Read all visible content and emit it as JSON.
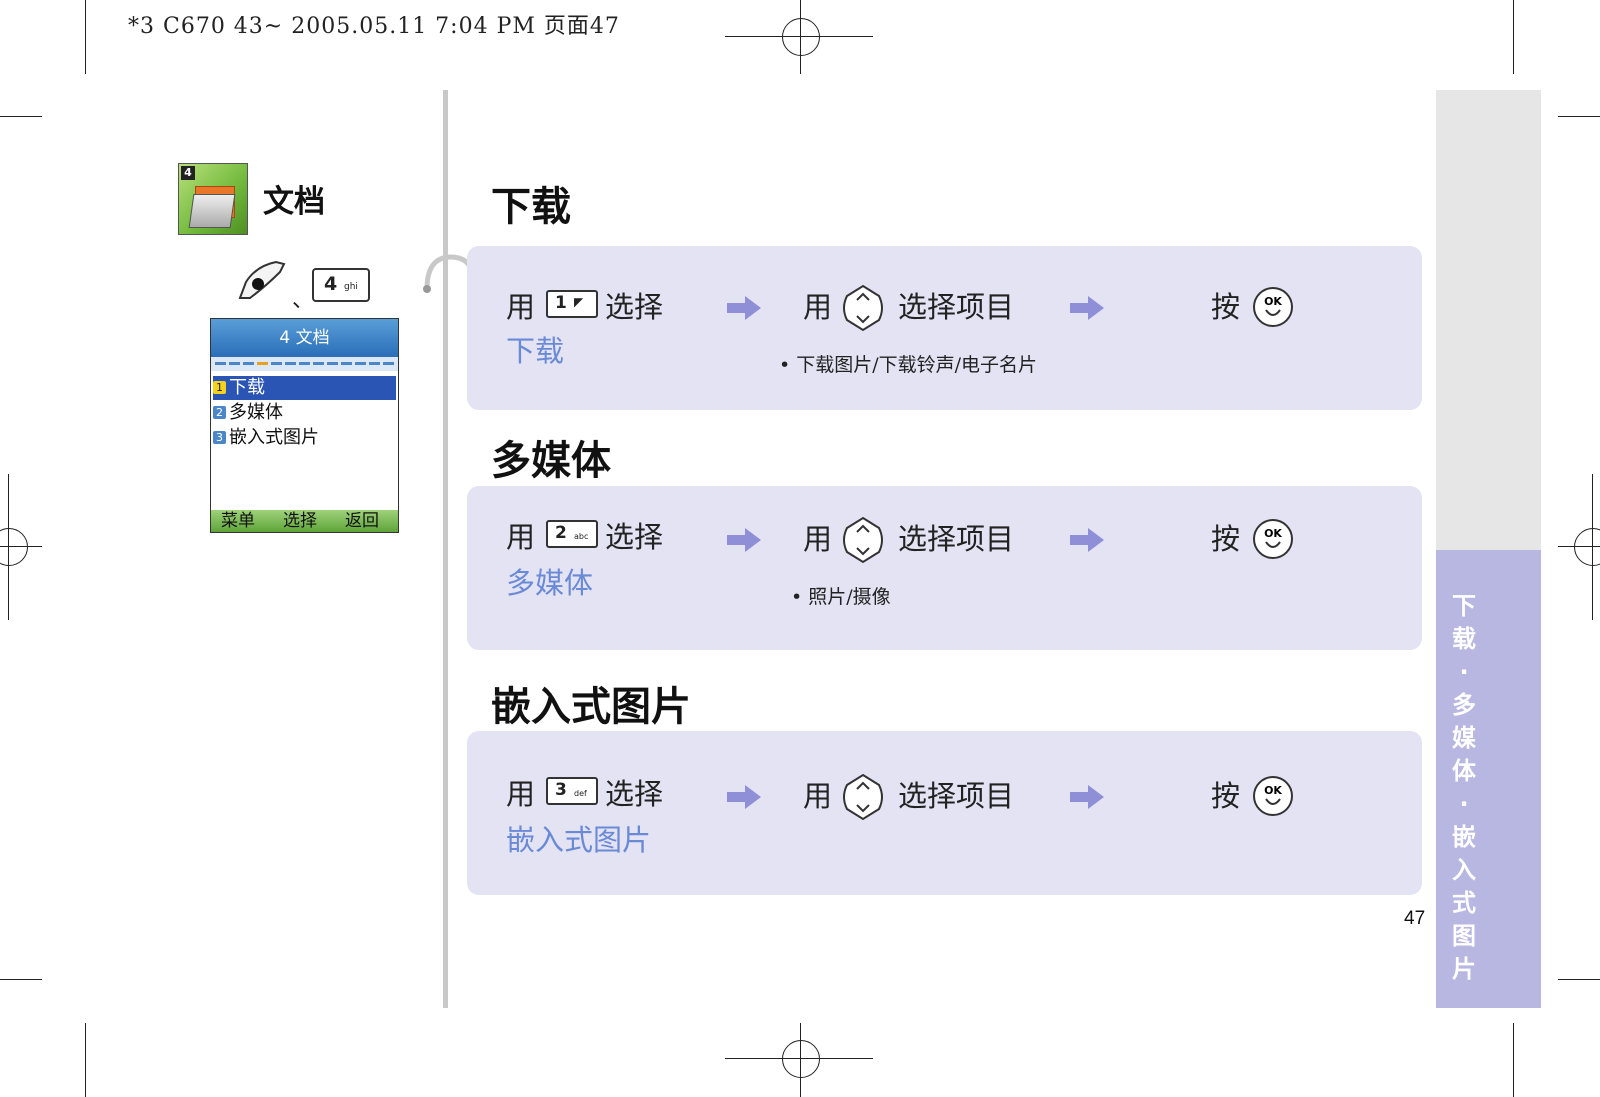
{
  "header": {
    "print_info": "*3 C670 43~ 2005.05.11 7:04 PM 页面47"
  },
  "sidebar": {
    "app_icon_number": "4",
    "app_title": "文档",
    "shortcut_separator": "、",
    "shortcut_key": {
      "digit": "4",
      "letters": "ghi"
    },
    "phone": {
      "title": "4 文档",
      "items": [
        {
          "num": "1",
          "label": "下载",
          "selected": true
        },
        {
          "num": "2",
          "label": "多媒体",
          "selected": false
        },
        {
          "num": "3",
          "label": "嵌入式图片",
          "selected": false
        }
      ],
      "softkeys": [
        "菜单",
        "选择",
        "返回"
      ]
    }
  },
  "sections": [
    {
      "title": "下载",
      "step1_prefix": "用",
      "key_digit": "1",
      "key_letters": "",
      "step1_suffix": "选择",
      "target": "下载",
      "step2_prefix": "用",
      "step2_suffix": "选择项目",
      "note": "• 下载图片/下载铃声/电子名片",
      "step3": "按"
    },
    {
      "title": "多媒体",
      "step1_prefix": "用",
      "key_digit": "2",
      "key_letters": "abc",
      "step1_suffix": "选择",
      "target": "多媒体",
      "step2_prefix": "用",
      "step2_suffix": "选择项目",
      "note": "• 照片/摄像",
      "step3": "按"
    },
    {
      "title": "嵌入式图片",
      "step1_prefix": "用",
      "key_digit": "3",
      "key_letters": "def",
      "step1_suffix": "选择",
      "target": "嵌入式图片",
      "step2_prefix": "用",
      "step2_suffix": "选择项目",
      "note": "",
      "step3": "按"
    }
  ],
  "ok_label": "OK",
  "side_tab": {
    "label": "下载·多媒体·嵌入式图片"
  },
  "page_number": "47",
  "colors": {
    "panel": "#e3e3f4",
    "side_tab": "#b7b7e2",
    "link_blue": "#6a8ad6",
    "arrow": "#8f8fd8"
  }
}
